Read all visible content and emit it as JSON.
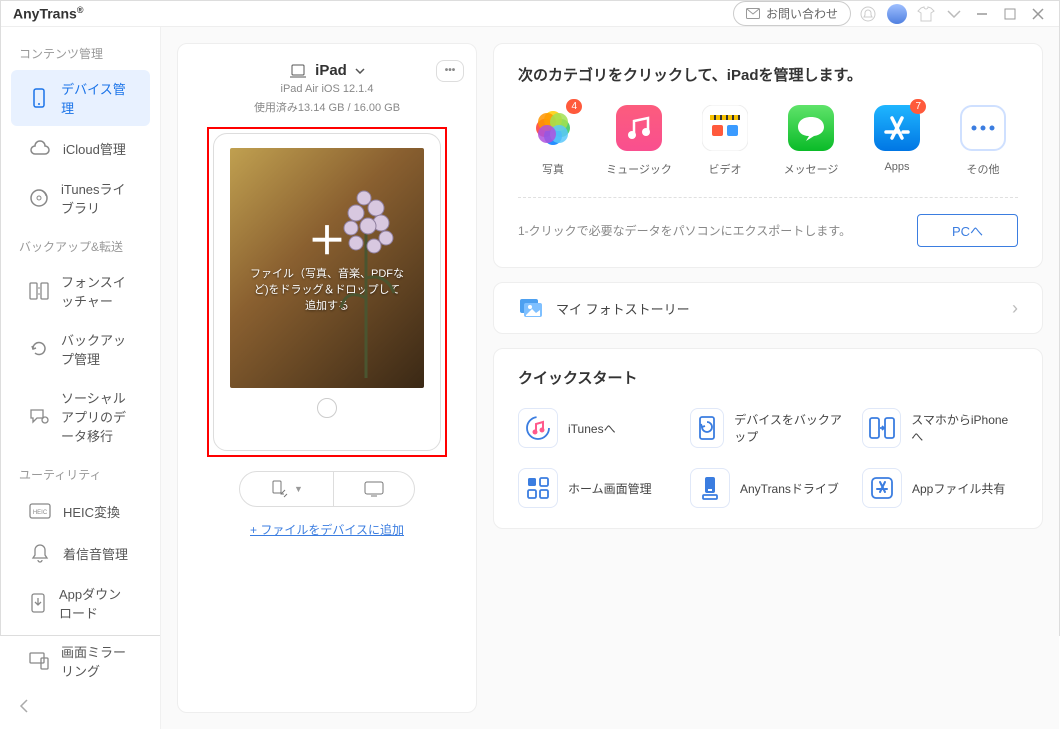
{
  "app": {
    "title": "AnyTrans",
    "reg": "®",
    "contact": "お問い合わせ"
  },
  "sidebar": {
    "groups": [
      {
        "heading": "コンテンツ管理",
        "items": [
          {
            "label": "デバイス管理",
            "active": true,
            "icon": "phone"
          },
          {
            "label": "iCloud管理",
            "active": false,
            "icon": "cloud"
          },
          {
            "label": "iTunesライブラリ",
            "active": false,
            "icon": "disc"
          }
        ]
      },
      {
        "heading": "バックアップ&転送",
        "items": [
          {
            "label": "フォンスイッチャー",
            "active": false,
            "icon": "switch"
          },
          {
            "label": "バックアップ管理",
            "active": false,
            "icon": "refresh"
          },
          {
            "label": "ソーシャルアプリのデータ移行",
            "active": false,
            "icon": "chat"
          }
        ]
      },
      {
        "heading": "ユーティリティ",
        "items": [
          {
            "label": "HEIC変換",
            "active": false,
            "icon": "heic"
          },
          {
            "label": "着信音管理",
            "active": false,
            "icon": "bell"
          },
          {
            "label": "Appダウンロード",
            "active": false,
            "icon": "download"
          },
          {
            "label": "画面ミラーリング",
            "active": false,
            "icon": "mirror"
          }
        ]
      }
    ]
  },
  "device": {
    "name": "iPad",
    "model": "iPad Air iOS 12.1.4",
    "storage": "使用済み13.14 GB / 16.00 GB",
    "drop_text": "ファイル（写真、音楽、PDFなど)をドラッグ＆ドロップして追加する",
    "add_link": "+ ファイルをデバイスに追加"
  },
  "categories": {
    "title": "次のカテゴリをクリックして、iPadを管理します。",
    "items": [
      {
        "label": "写真",
        "badge": "4",
        "key": "photos"
      },
      {
        "label": "ミュージック",
        "badge": null,
        "key": "music"
      },
      {
        "label": "ビデオ",
        "badge": null,
        "key": "video"
      },
      {
        "label": "メッセージ",
        "badge": null,
        "key": "message"
      },
      {
        "label": "Apps",
        "badge": "7",
        "key": "apps"
      },
      {
        "label": "その他",
        "badge": null,
        "key": "other"
      }
    ],
    "export_hint": "1-クリックで必要なデータをパソコンにエクスポートします。",
    "pc_button": "PCへ"
  },
  "story": {
    "label": "マイ フォトストーリー"
  },
  "quickstart": {
    "title": "クイックスタート",
    "items": [
      {
        "label": "iTunesへ",
        "icon": "itunes"
      },
      {
        "label": "デバイスをバックアップ",
        "icon": "backup"
      },
      {
        "label": "スマホからiPhoneへ",
        "icon": "toiphone"
      },
      {
        "label": "ホーム画面管理",
        "icon": "home"
      },
      {
        "label": "AnyTransドライブ",
        "icon": "drive"
      },
      {
        "label": "Appファイル共有",
        "icon": "share"
      }
    ]
  }
}
